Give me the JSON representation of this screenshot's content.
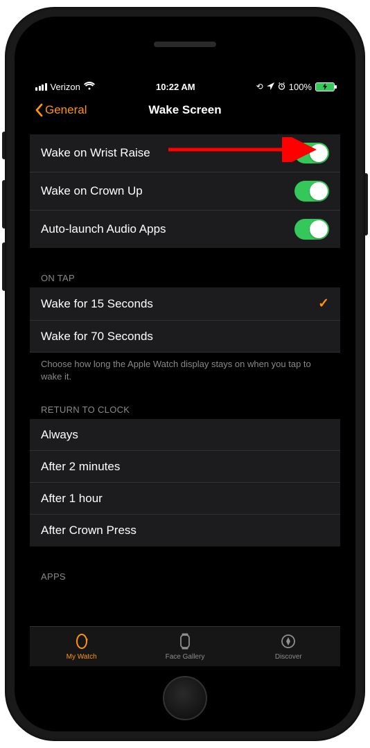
{
  "status": {
    "carrier": "Verizon",
    "time": "10:22 AM",
    "battery_text": "100%"
  },
  "nav": {
    "back_label": "General",
    "title": "Wake Screen"
  },
  "toggles": [
    {
      "label": "Wake on Wrist Raise",
      "on": true
    },
    {
      "label": "Wake on Crown Up",
      "on": true
    },
    {
      "label": "Auto-launch Audio Apps",
      "on": true
    }
  ],
  "on_tap": {
    "header": "ON TAP",
    "options": [
      {
        "label": "Wake for 15 Seconds",
        "selected": true
      },
      {
        "label": "Wake for 70 Seconds",
        "selected": false
      }
    ],
    "footer": "Choose how long the Apple Watch display stays on when you tap to wake it."
  },
  "return_to_clock": {
    "header": "RETURN TO CLOCK",
    "options": [
      {
        "label": "Always"
      },
      {
        "label": "After 2 minutes"
      },
      {
        "label": "After 1 hour"
      },
      {
        "label": "After Crown Press"
      }
    ]
  },
  "apps": {
    "header": "APPS"
  },
  "tabs": [
    {
      "label": "My Watch",
      "active": true
    },
    {
      "label": "Face Gallery",
      "active": false
    },
    {
      "label": "Discover",
      "active": false
    }
  ],
  "annotation": {
    "color": "#ff0000"
  }
}
